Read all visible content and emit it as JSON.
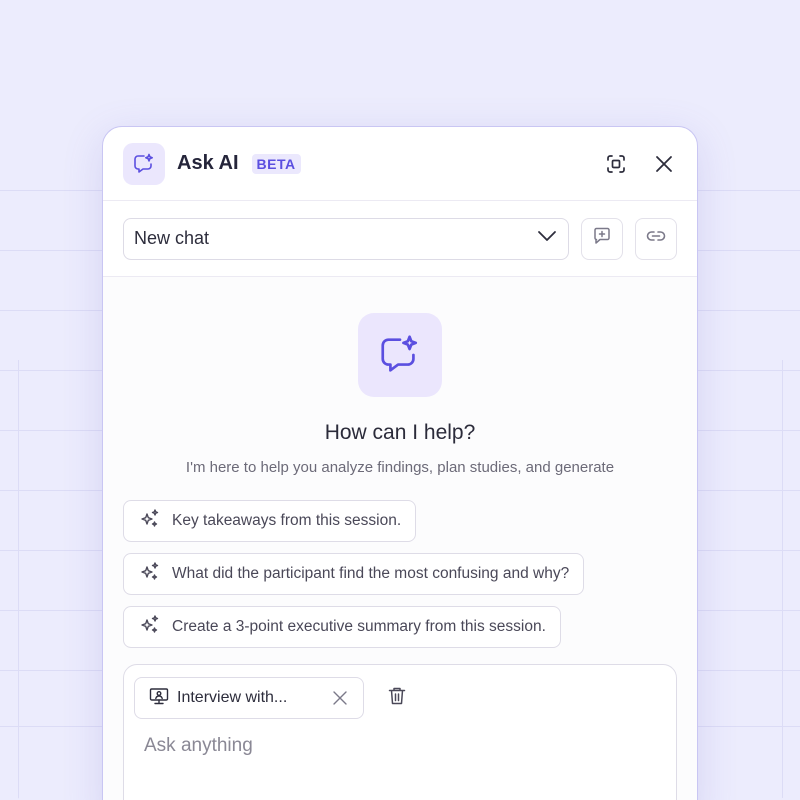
{
  "colors": {
    "background": "#ececfd",
    "accent": "#5b4fe0",
    "icon_bg": "#ebe7fd"
  },
  "header": {
    "logo_icon": "chat-sparkle-icon",
    "title": "Ask AI",
    "badge": "BETA",
    "actions": [
      {
        "icon": "focus-frame-icon"
      },
      {
        "icon": "close-icon"
      }
    ]
  },
  "toolbar": {
    "chat_select_value": "New chat",
    "new_chat_icon": "message-plus-icon",
    "link_icon": "link-icon"
  },
  "welcome": {
    "icon": "chat-sparkle-icon",
    "heading": "How can I help?",
    "subtext": "I'm here to help you analyze findings, plan studies, and generate"
  },
  "suggestions": [
    {
      "icon": "sparkles-icon",
      "label": "Key takeaways from this session."
    },
    {
      "icon": "sparkles-icon",
      "label": "What did the participant find the most confusing and why?"
    },
    {
      "icon": "sparkles-icon",
      "label": "Create a 3-point executive summary from this session."
    }
  ],
  "composer": {
    "attachment": {
      "icon": "screen-person-icon",
      "label": "Interview with..."
    },
    "delete_icon": "trash-icon",
    "placeholder": "Ask anything"
  }
}
